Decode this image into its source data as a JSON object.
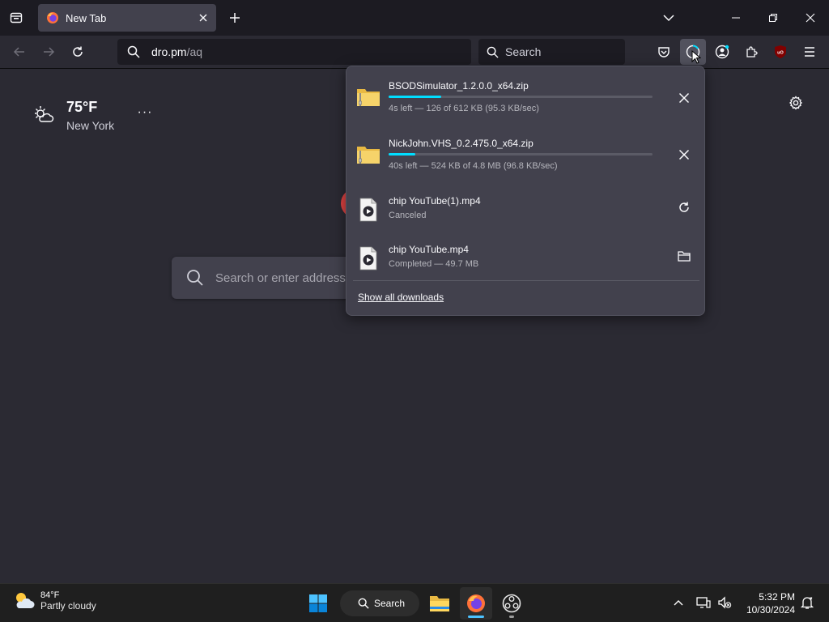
{
  "tab": {
    "title": "New Tab"
  },
  "urlbar": {
    "host": "dro.pm",
    "path": "/aq"
  },
  "searchbar": {
    "placeholder": "Search"
  },
  "weather": {
    "temp": "75°F",
    "city": "New York",
    "more": "···"
  },
  "ntp_search": {
    "placeholder": "Search or enter address"
  },
  "downloads": {
    "items": [
      {
        "name": "BSODSimulator_1.2.0.0_x64.zip",
        "status": "4s left — 126 of 612 KB (95.3 KB/sec)",
        "progress": 0.2,
        "type": "zip",
        "action": "cancel"
      },
      {
        "name": "NickJohn.VHS_0.2.475.0_x64.zip",
        "status": "40s left — 524 KB of 4.8 MB (96.8 KB/sec)",
        "progress": 0.1,
        "type": "zip",
        "action": "cancel"
      },
      {
        "name": "chip YouTube(1).mp4",
        "status": "Canceled",
        "type": "video",
        "action": "retry"
      },
      {
        "name": "chip YouTube.mp4",
        "status": "Completed — 49.7 MB",
        "type": "video",
        "action": "show-in-folder"
      }
    ],
    "show_all": "Show all downloads"
  },
  "taskbar": {
    "weather_temp": "84°F",
    "weather_desc": "Partly cloudy",
    "search_label": "Search",
    "time": "5:32 PM",
    "date": "10/30/2024"
  },
  "colors": {
    "accent": "#00ddff",
    "panel": "#42414d",
    "background": "#2b2a33",
    "toolbar": "#1c1b22"
  }
}
